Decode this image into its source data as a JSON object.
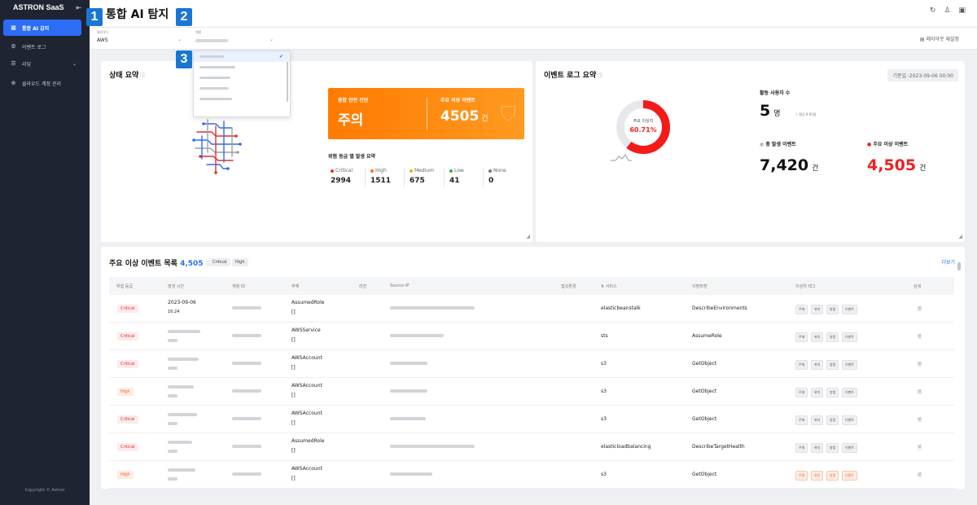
{
  "app": {
    "name": "ASTRON SaaS",
    "copyright": "Copyright © Astron",
    "collapse_icon": "collapse-icon"
  },
  "sidebar": {
    "items": [
      {
        "label": "통합 AI 감지",
        "icon": "grid-icon",
        "active": true
      },
      {
        "label": "이벤트 로그",
        "icon": "gear-icon",
        "active": false
      },
      {
        "label": "리딩",
        "icon": "list-icon",
        "active": false,
        "has_children": true
      },
      {
        "label": "클라우드 계정 관리",
        "icon": "globe-icon",
        "active": false
      }
    ]
  },
  "header": {
    "title": "통합 AI 탐지",
    "icons": [
      "refresh-icon",
      "user-icon",
      "bookmark-icon"
    ]
  },
  "filters": {
    "cloud_label": "클라우드",
    "cloud_value": "AWS",
    "account_label": "계정",
    "layout_reset": "레이아웃 재설정"
  },
  "badges": [
    "1",
    "2",
    "3"
  ],
  "status_summary": {
    "title": "상태 요약",
    "overall_label": "종합 안전 진단",
    "overall_value": "주의",
    "anomaly_label": "주요 이상 이벤트",
    "anomaly_value": "4505",
    "anomaly_unit": "건",
    "risk_title": "위험 등급 별 발생 요약",
    "risks": [
      {
        "name": "Critical",
        "value": "2994",
        "color": "#e03030"
      },
      {
        "name": "High",
        "value": "1511",
        "color": "#f07a20"
      },
      {
        "name": "Medium",
        "value": "675",
        "color": "#f0b020"
      },
      {
        "name": "Low",
        "value": "41",
        "color": "#30b050"
      },
      {
        "name": "None",
        "value": "0",
        "color": "#777777"
      }
    ]
  },
  "event_summary": {
    "title": "이벤트 로그 요약",
    "date": "기준일 :2023-09-06 00:00",
    "donut_label": "주요 이상치",
    "donut_value": "60.71%",
    "donut_fraction": 0.6071,
    "active_users_label": "활동 사용자 수",
    "active_users_value": "5",
    "active_users_unit": "명",
    "active_users_avg": "평균 9.93명",
    "total_events_label": "총 발생 이벤트",
    "total_events_value": "7,420",
    "total_events_unit": "건",
    "anomaly_events_label": "주요 이상 이벤트",
    "anomaly_events_value": "4,505",
    "anomaly_events_unit": "건"
  },
  "events_table": {
    "title": "주요 이상 이벤트 목록",
    "count": "4,505",
    "chips": [
      "Critical",
      "High"
    ],
    "more": "더보기",
    "headers": [
      "위험 등급",
      "발생 시간",
      "계정 ID",
      "주체",
      "리전",
      "Source IP",
      "접속환경",
      "서비스",
      "이벤트명",
      "이상치 태그",
      "상세"
    ],
    "tags": [
      "주체",
      "위치",
      "방법",
      "이벤트"
    ],
    "rows": [
      {
        "severity": "Critical",
        "time1": "2023-09-06",
        "time2": "16:24",
        "principal": "AssumedRole",
        "principal_sub": "[]",
        "service": "elasticbeanstalk",
        "event": "DescribeEnvironments"
      },
      {
        "severity": "Critical",
        "time1": "",
        "time2": "",
        "principal": "AWSService",
        "principal_sub": "[]",
        "service": "sts",
        "event": "AssumeRole"
      },
      {
        "severity": "Critical",
        "time1": "",
        "time2": "",
        "principal": "AWSAccount",
        "principal_sub": "[]",
        "service": "s3",
        "event": "GetObject"
      },
      {
        "severity": "High",
        "time1": "",
        "time2": "",
        "principal": "AWSAccount",
        "principal_sub": "[]",
        "service": "s3",
        "event": "GetObject"
      },
      {
        "severity": "Critical",
        "time1": "",
        "time2": "",
        "principal": "AWSAccount",
        "principal_sub": "[]",
        "service": "s3",
        "event": "GetObject"
      },
      {
        "severity": "Critical",
        "time1": "",
        "time2": "",
        "principal": "AssumedRole",
        "principal_sub": "[]",
        "service": "elasticloadbalancing",
        "event": "DescribeTargetHealth"
      },
      {
        "severity": "High",
        "time1": "",
        "time2": "",
        "principal": "AWSAccount",
        "principal_sub": "[]",
        "service": "s3",
        "event": "GetObject"
      }
    ]
  }
}
